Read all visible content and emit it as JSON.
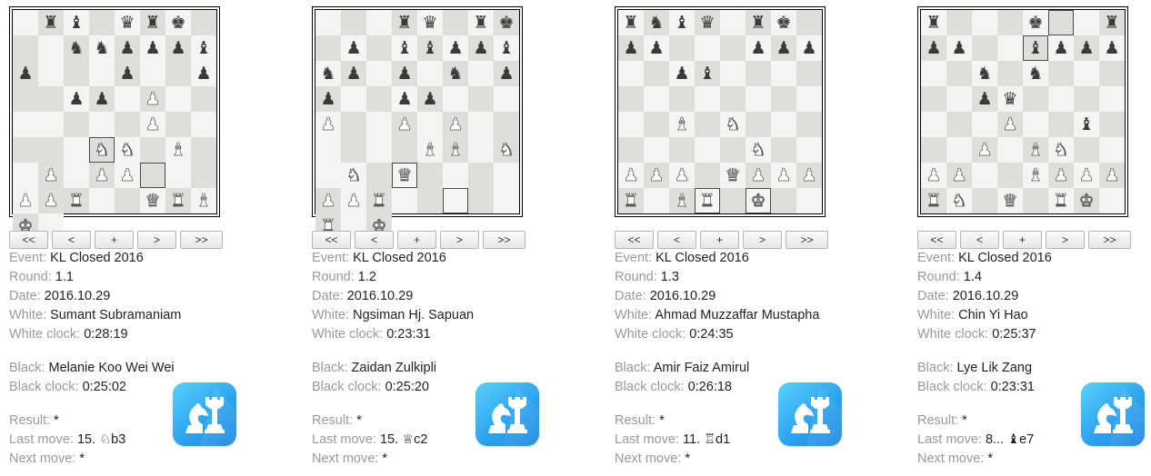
{
  "nav_labels": [
    "<<",
    "<",
    "+",
    ">",
    ">>"
  ],
  "labels": {
    "event": "Event:",
    "round": "Round:",
    "date": "Date:",
    "white": "White:",
    "white_clock": "White clock:",
    "black": "Black:",
    "black_clock": "Black clock:",
    "result": "Result:",
    "last_move": "Last move:",
    "next_move": "Next move:"
  },
  "colors": {
    "light_square": "#f4f4f2",
    "dark_square": "#dededa",
    "logo": "#2da4ef"
  },
  "games": [
    {
      "board": [
        "1rb1qrk1",
        "2nnpppbp",
        "3p2p1",
        "1pp1P3",
        "4P3",
        "2NN1B2P",
        "1PP3PP",
        "R2QRBK1"
      ],
      "highlights": [
        "c3",
        "d2"
      ],
      "event": "KL Closed 2016",
      "round": "1.1",
      "date": "2016.10.29",
      "white": "Sumant Subramaniam",
      "white_clock": "0:28:19",
      "black": "Melanie Koo Wei Wei",
      "black_clock": "0:25:02",
      "result": "*",
      "last_move": "15. ♘b3",
      "next_move": "*"
    },
    {
      "board": [
        "3rq1rk",
        "1p1bbppb",
        "np1p1n1p",
        "p2pp3",
        "P2P1P3",
        "3BB1N1",
        "N1Q4PP",
        "R5R1K"
      ],
      "highlights": [
        "c2",
        "d1"
      ],
      "event": "KL Closed 2016",
      "round": "1.2",
      "date": "2016.10.29",
      "white": "Ngsiman Hj. Sapuan",
      "white_clock": "0:23:31",
      "black": "Zaidan Zulkipli",
      "black_clock": "0:25:20",
      "result": "*",
      "last_move": "15. ♕c2",
      "next_move": "*"
    },
    {
      "board": [
        "rnbq1rk1",
        "pp3ppp",
        "2pb4",
        "8",
        "2B1N3",
        "5N2",
        "PPP1QPPP",
        "R1BR1K2"
      ],
      "highlights": [
        "d1",
        "f1"
      ],
      "event": "KL Closed 2016",
      "round": "1.3",
      "date": "2016.10.29",
      "white": "Ahmad Muzzaffar Mustapha",
      "white_clock": "0:24:35",
      "black": "Amir Faiz Amirul",
      "black_clock": "0:26:18",
      "result": "*",
      "last_move": "11. ♖d1",
      "next_move": "*"
    },
    {
      "board": [
        "r3k2r",
        "pp2bppp",
        "2n1n3",
        "2pq4",
        "3P2b1",
        "2P1BN2",
        "PP2BPPP",
        "RN1Q1RK1"
      ],
      "highlights": [
        "f8",
        "e7"
      ],
      "event": "KL Closed 2016",
      "round": "1.4",
      "date": "2016.10.29",
      "white": "Chin Yi Hao",
      "white_clock": "0:25:37",
      "black": "Lye Lik Zang",
      "black_clock": "0:23:31",
      "result": "*",
      "last_move": "8... ♝e7",
      "next_move": "*"
    }
  ]
}
